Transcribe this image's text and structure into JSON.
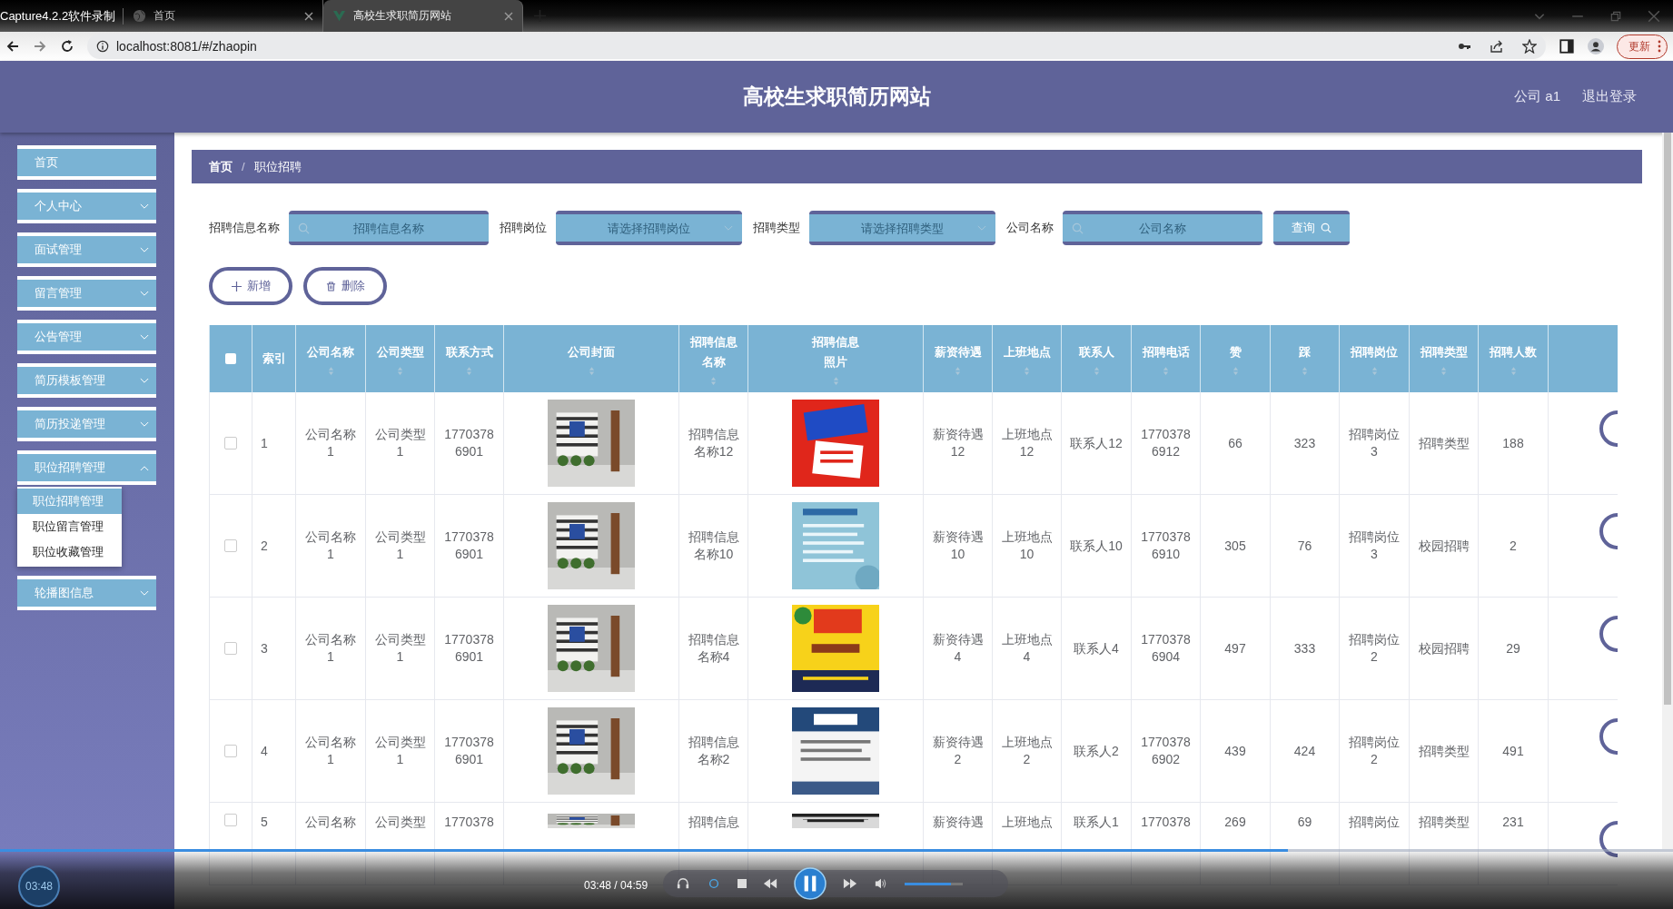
{
  "window_title": "Capture4.2.2软件录制",
  "browser": {
    "tabs": [
      {
        "title": "首页",
        "selected": false
      },
      {
        "title": "高校生求职简历网站",
        "selected": true
      }
    ],
    "url": "localhost:8081/#/zhaopin",
    "update_button": "更新"
  },
  "header": {
    "title": "高校生求职简历网站",
    "user": "公司 a1",
    "logout": "退出登录"
  },
  "sidebar": {
    "items": [
      {
        "label": "首页",
        "expandable": false
      },
      {
        "label": "个人中心",
        "expandable": true,
        "expanded": false
      },
      {
        "label": "面试管理",
        "expandable": true,
        "expanded": false
      },
      {
        "label": "留言管理",
        "expandable": true,
        "expanded": false
      },
      {
        "label": "公告管理",
        "expandable": true,
        "expanded": false
      },
      {
        "label": "简历模板管理",
        "expandable": true,
        "expanded": false
      },
      {
        "label": "简历投递管理",
        "expandable": true,
        "expanded": false
      },
      {
        "label": "职位招聘管理",
        "expandable": true,
        "expanded": true,
        "children": [
          {
            "label": "职位招聘管理",
            "selected": true
          },
          {
            "label": "职位留言管理",
            "selected": false
          },
          {
            "label": "职位收藏管理",
            "selected": false
          }
        ]
      },
      {
        "label": "轮播图信息",
        "expandable": true,
        "expanded": false
      }
    ]
  },
  "breadcrumb": [
    "首页",
    "职位招聘"
  ],
  "breadcrumb_separator": "/",
  "filters": [
    {
      "label": "招聘信息名称",
      "placeholder": "招聘信息名称",
      "kind": "text"
    },
    {
      "label": "招聘岗位",
      "placeholder": "请选择招聘岗位",
      "kind": "select"
    },
    {
      "label": "招聘类型",
      "placeholder": "请选择招聘类型",
      "kind": "select"
    },
    {
      "label": "公司名称",
      "placeholder": "公司名称",
      "kind": "text"
    }
  ],
  "query_button": "查询",
  "actions": {
    "add": "新增",
    "delete": "删除"
  },
  "table": {
    "all_checked": false,
    "columns": [
      {
        "label": "索引",
        "sortable": false
      },
      {
        "label": "公司名称",
        "sortable": true
      },
      {
        "label": "公司类型",
        "sortable": true
      },
      {
        "label": "联系方式",
        "sortable": true
      },
      {
        "label": "公司封面",
        "sortable": true
      },
      {
        "label": "招聘信息名称",
        "sortable": true
      },
      {
        "label": "招聘信息照片",
        "sortable": true
      },
      {
        "label": "薪资待遇",
        "sortable": true
      },
      {
        "label": "上班地点",
        "sortable": true
      },
      {
        "label": "联系人",
        "sortable": true
      },
      {
        "label": "招聘电话",
        "sortable": true
      },
      {
        "label": "赞",
        "sortable": true
      },
      {
        "label": "踩",
        "sortable": true
      },
      {
        "label": "招聘岗位",
        "sortable": true
      },
      {
        "label": "招聘类型",
        "sortable": true
      },
      {
        "label": "招聘人数",
        "sortable": true
      }
    ],
    "rows": [
      {
        "checked": false,
        "cells": [
          "1",
          "公司名称1",
          "公司类型1",
          "17703786901",
          {
            "kind": "picture"
          },
          "招聘信息名称12",
          {
            "kind": "picture"
          },
          "薪资待遇12",
          "上班地点12",
          "联系人12",
          "17703786912",
          "66",
          "323",
          "招聘岗位3",
          "招聘类型",
          "188"
        ]
      },
      {
        "checked": false,
        "cells": [
          "2",
          "公司名称1",
          "公司类型1",
          "17703786901",
          {
            "kind": "picture"
          },
          "招聘信息名称10",
          {
            "kind": "picture"
          },
          "薪资待遇10",
          "上班地点10",
          "联系人10",
          "17703786910",
          "305",
          "76",
          "招聘岗位3",
          "校园招聘",
          "2"
        ]
      },
      {
        "checked": false,
        "cells": [
          "3",
          "公司名称1",
          "公司类型1",
          "17703786901",
          {
            "kind": "picture"
          },
          "招聘信息名称4",
          {
            "kind": "picture"
          },
          "薪资待遇4",
          "上班地点4",
          "联系人4",
          "17703786904",
          "497",
          "333",
          "招聘岗位2",
          "校园招聘",
          "29"
        ]
      },
      {
        "checked": false,
        "cells": [
          "4",
          "公司名称1",
          "公司类型1",
          "17703786901",
          {
            "kind": "picture"
          },
          "招聘信息名称2",
          {
            "kind": "picture"
          },
          "薪资待遇2",
          "上班地点2",
          "联系人2",
          "17703786902",
          "439",
          "424",
          "招聘岗位2",
          "招聘类型",
          "491"
        ]
      },
      {
        "checked": false,
        "cells": [
          "5",
          "公司名称",
          "公司类型",
          "1770378",
          {
            "kind": "picture"
          },
          "招聘信息",
          {
            "kind": "picture"
          },
          "薪资待遇",
          "上班地点",
          "联系人1",
          "1770378",
          "269",
          "69",
          "招聘岗位",
          "招聘类型",
          "231"
        ]
      }
    ]
  },
  "player": {
    "badge_time": "03:48",
    "time": "03:48 / 04:59",
    "progress": {
      "level": 0.77
    },
    "volume": {
      "level": 0.8
    }
  }
}
